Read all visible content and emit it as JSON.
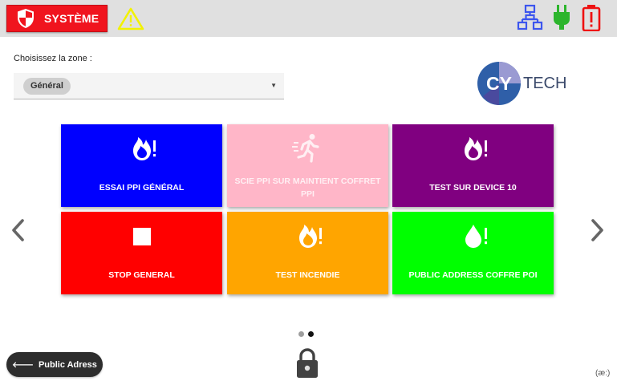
{
  "topbar": {
    "system_label": "SYSTÈME",
    "system_color": "#f0141e",
    "status_icons": [
      "network-icon",
      "power-plug-icon",
      "battery-alert-icon"
    ],
    "warning_icon": "warning-triangle-icon"
  },
  "zone": {
    "label": "Choisissez la zone :",
    "selected": "Général"
  },
  "logo": {
    "text_cy": "CY",
    "text_tech": "TECH"
  },
  "tiles": [
    {
      "label": "ESSAI PPI GÉNÉRAL",
      "color": "#0000ff",
      "icon": "fire-alert-icon",
      "faded": false
    },
    {
      "label": "SCIE PPI SUR MAINTIENT COFFRET PPI",
      "color": "#ffb6c8",
      "icon": "running-exit-icon",
      "faded": true
    },
    {
      "label": "TEST SUR DEVICE 10",
      "color": "#800080",
      "icon": "fire-alert-icon",
      "faded": false
    },
    {
      "label": "STOP GENERAL",
      "color": "#ff0000",
      "icon": "stop-square-icon",
      "faded": false
    },
    {
      "label": "TEST INCENDIE",
      "color": "#ffa500",
      "icon": "fire-alert-icon",
      "faded": false
    },
    {
      "label": "PUBLIC ADDRESS COFFRE POI",
      "color": "#00ff00",
      "icon": "water-drop-alert-icon",
      "faded": false
    }
  ],
  "pagination": {
    "pages": 2,
    "current": 2
  },
  "footer": {
    "public_address_label": "Public Adress",
    "badge": "(æ:)"
  }
}
